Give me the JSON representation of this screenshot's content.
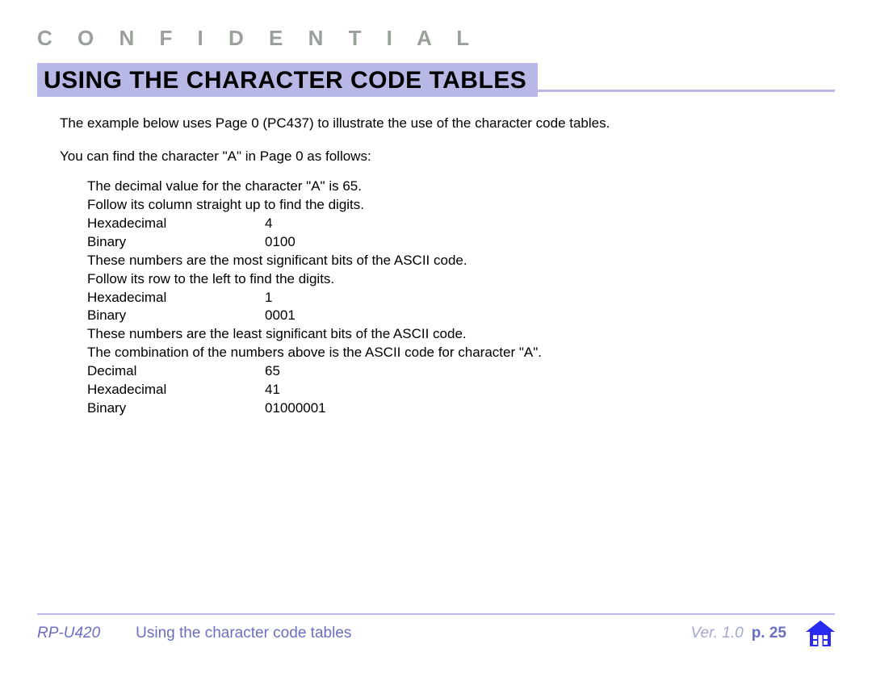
{
  "header": {
    "confidential": "C O N F I D E N T I A L",
    "title": "USING THE CHARACTER CODE TABLES"
  },
  "body": {
    "intro": "The example below uses Page 0 (PC437) to illustrate the use of the character code tables.",
    "sub": "You can find the character \"A\" in Page 0 as follows:",
    "lines": {
      "l1": "The decimal value for the character \"A\" is 65.",
      "l2": "Follow its column straight up to find the digits.",
      "l3_label": "Hexadecimal",
      "l3_val": "4",
      "l4_label": "Binary",
      "l4_val": "0100",
      "l5": "These numbers are the most significant bits of the ASCII code.",
      "l6": "Follow its row to the left to find the digits.",
      "l7_label": "Hexadecimal",
      "l7_val": "1",
      "l8_label": "Binary",
      "l8_val": "0001",
      "l9": "These numbers are the least significant bits of the ASCII code.",
      "l10": "The combination of the numbers above is the ASCII code for character \"A\".",
      "l11_label": "Decimal",
      "l11_val": "65",
      "l12_label": "Hexadecimal",
      "l12_val": "41",
      "l13_label": "Binary",
      "l13_val": "01000001"
    }
  },
  "footer": {
    "model": "RP-U420",
    "section": "Using the character code tables",
    "ver": "Ver. 1.0",
    "page": "p. 25"
  }
}
